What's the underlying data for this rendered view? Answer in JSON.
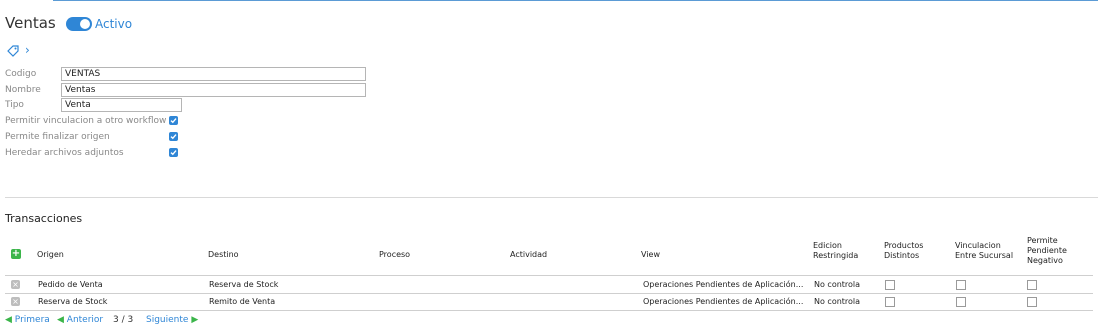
{
  "header": {
    "title": "Ventas",
    "toggle_label": "Activo"
  },
  "fields": {
    "codigo": {
      "label": "Codigo",
      "value": "VENTAS"
    },
    "nombre": {
      "label": "Nombre",
      "value": "Ventas"
    },
    "tipo": {
      "label": "Tipo",
      "value": "Venta"
    },
    "permitir_vinculacion": {
      "label": "Permitir vinculacion a otro workflow",
      "checked": true
    },
    "permite_finalizar": {
      "label": "Permite finalizar origen",
      "checked": true
    },
    "heredar_archivos": {
      "label": "Heredar archivos adjuntos",
      "checked": true
    }
  },
  "transacciones": {
    "title": "Transacciones",
    "headers": {
      "origen": "Origen",
      "destino": "Destino",
      "proceso": "Proceso",
      "actividad": "Actividad",
      "view": "View",
      "edicion_1": "Edicion",
      "edicion_2": "Restringida",
      "productos_1": "Productos",
      "productos_2": "Distintos",
      "vinculacion_1": "Vinculacion",
      "vinculacion_2": "Entre Sucursal",
      "permite_1": "Permite",
      "permite_2": "Pendiente",
      "permite_3": "Negativo"
    },
    "rows": [
      {
        "origen": "Pedido de Venta",
        "destino": "Reserva de Stock",
        "proceso": "",
        "actividad": "",
        "view": "Operaciones Pendientes de Aplicación...",
        "edicion": "No controla",
        "productos": false,
        "vinculacion": false,
        "permite": false
      },
      {
        "origen": "Reserva de Stock",
        "destino": "Remito de Venta",
        "proceso": "",
        "actividad": "",
        "view": "Operaciones Pendientes de Aplicación...",
        "edicion": "No controla",
        "productos": false,
        "vinculacion": false,
        "permite": false
      }
    ]
  },
  "pager": {
    "first": "Primera",
    "prev": "Anterior",
    "current": "3 / 3",
    "next": "Siguiente"
  },
  "colors": {
    "accent": "#2f86d6",
    "add": "#3bb54a"
  }
}
